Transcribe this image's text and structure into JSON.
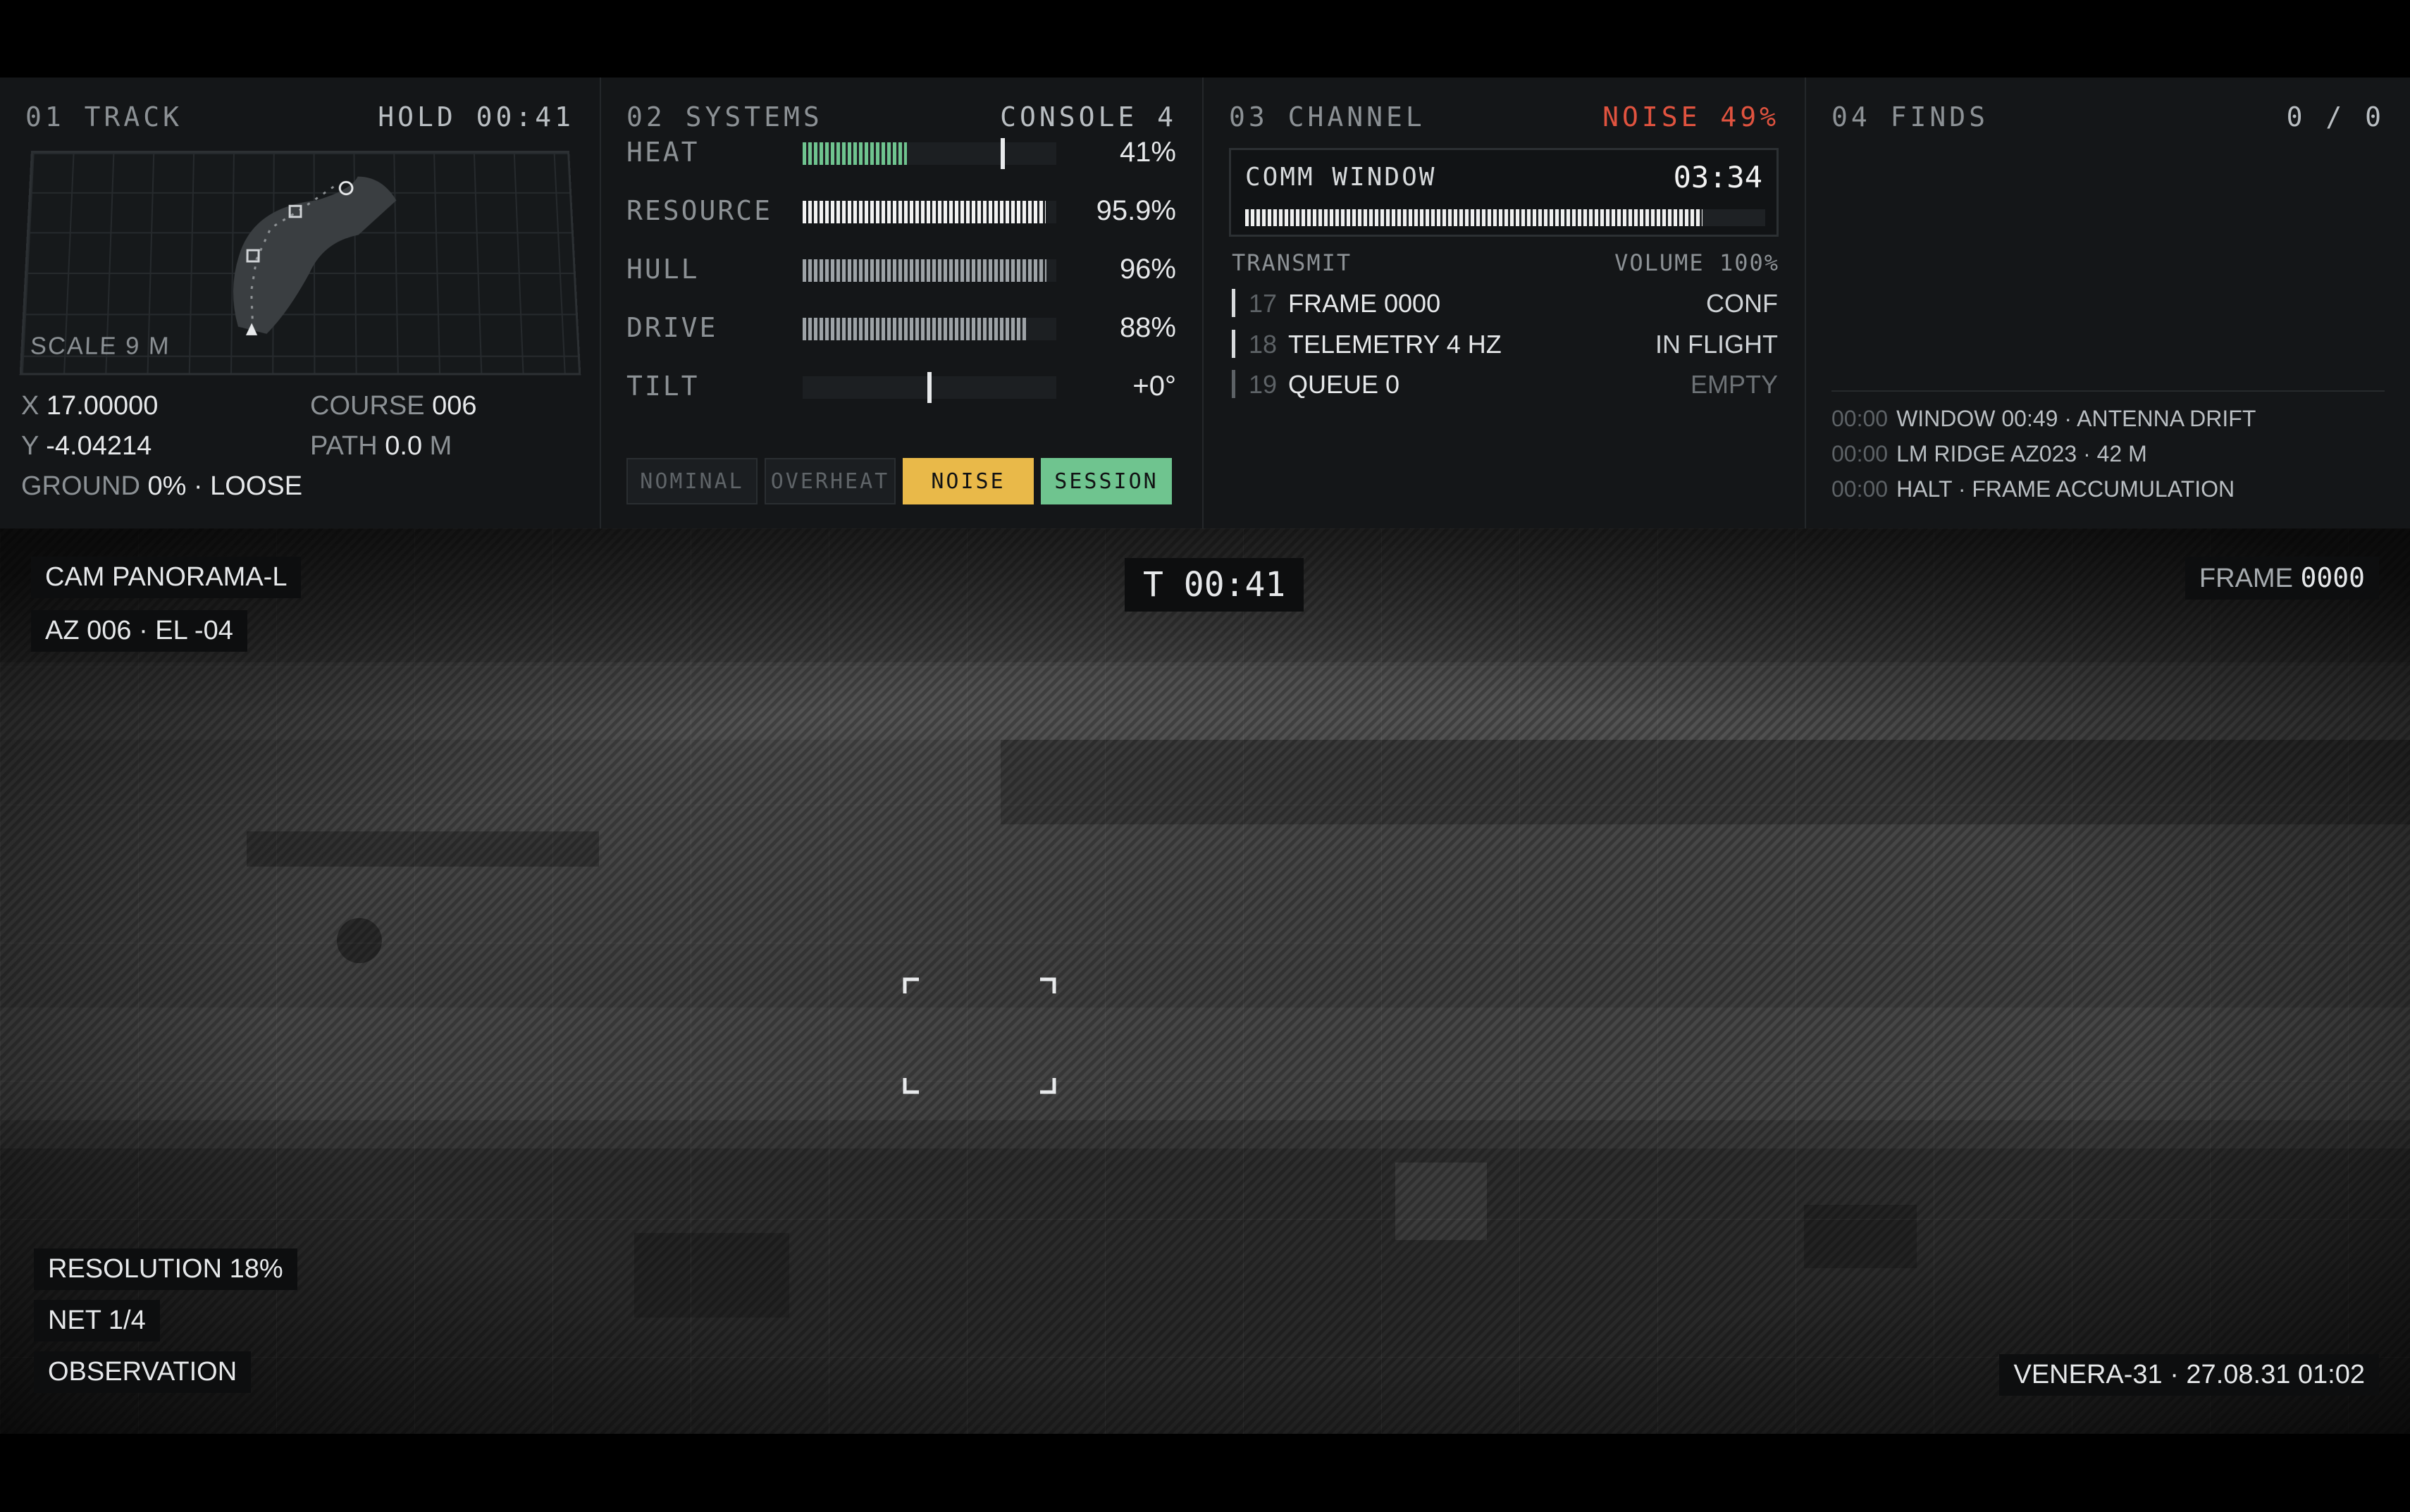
{
  "track": {
    "title": "01 TRACK",
    "status": "HOLD 00:41",
    "scale": "SCALE 9 M",
    "x_label": "X",
    "x_value": "17.00000",
    "y_label": "Y",
    "y_value": "-4.04214",
    "ground_label": "GROUND",
    "ground_value": "0% · LOOSE",
    "course_label": "COURSE",
    "course_value": "006",
    "path_label": "PATH",
    "path_value": "0.0",
    "path_unit": "M"
  },
  "systems": {
    "title": "02 SYSTEMS",
    "console": "CONSOLE 4",
    "rows": [
      {
        "label": "HEAT",
        "value": "41%",
        "level": 0.41,
        "color": "#6fc48f"
      },
      {
        "label": "RESOURCE",
        "value": "95.9%",
        "level": 0.959,
        "color": "#f3f3f3"
      },
      {
        "label": "HULL",
        "value": "96%",
        "level": 0.96,
        "color": "#9ea3a7"
      },
      {
        "label": "DRIVE",
        "value": "88%",
        "level": 0.88,
        "color": "#9ea3a7"
      },
      {
        "label": "TILT",
        "value": "+0°",
        "level": 0.5,
        "color": "#e8eaec"
      }
    ],
    "modes": [
      {
        "label": "NOMINAL",
        "active": false,
        "color": ""
      },
      {
        "label": "OVERHEAT",
        "active": false,
        "color": ""
      },
      {
        "label": "NOISE",
        "active": true,
        "color": "#e9b949"
      },
      {
        "label": "SESSION",
        "active": true,
        "color": "#6fc48f"
      }
    ]
  },
  "channel": {
    "title": "03 CHANNEL",
    "noise": "NOISE 49%",
    "noise_color": "#e0533f",
    "comm_label": "COMM WINDOW",
    "comm_time": "03:34",
    "comm_level": 0.88,
    "transmit_label": "TRANSMIT",
    "volume": "VOLUME 100%",
    "queue": [
      {
        "num": "17",
        "name": "FRAME 0000",
        "status": "CONF"
      },
      {
        "num": "18",
        "name": "TELEMETRY 4 HZ",
        "status": "IN FLIGHT"
      },
      {
        "num": "19",
        "name": "QUEUE 0",
        "status": "EMPTY"
      }
    ]
  },
  "finds": {
    "title": "04 FINDS",
    "count": "0 / 0",
    "log": [
      {
        "time": "00:00",
        "text": "WINDOW 00:49 · ANTENNA DRIFT"
      },
      {
        "time": "00:00",
        "text": "LM RIDGE AZ023 · 42 M"
      },
      {
        "time": "00:00",
        "text": "HALT · FRAME ACCUMULATION"
      }
    ]
  },
  "camera": {
    "name": "CAM PANORAMA-L",
    "az_el": "AZ 006 · EL -04",
    "timer": "T 00:41",
    "frame_label": "FRAME",
    "frame_value": "0000",
    "resolution_label": "RESOLUTION",
    "resolution_value": "18%",
    "net_label": "NET",
    "net_value": "1/4",
    "mode": "OBSERVATION",
    "stamp": "VENERA-31 · 27.08.31 01:02"
  }
}
